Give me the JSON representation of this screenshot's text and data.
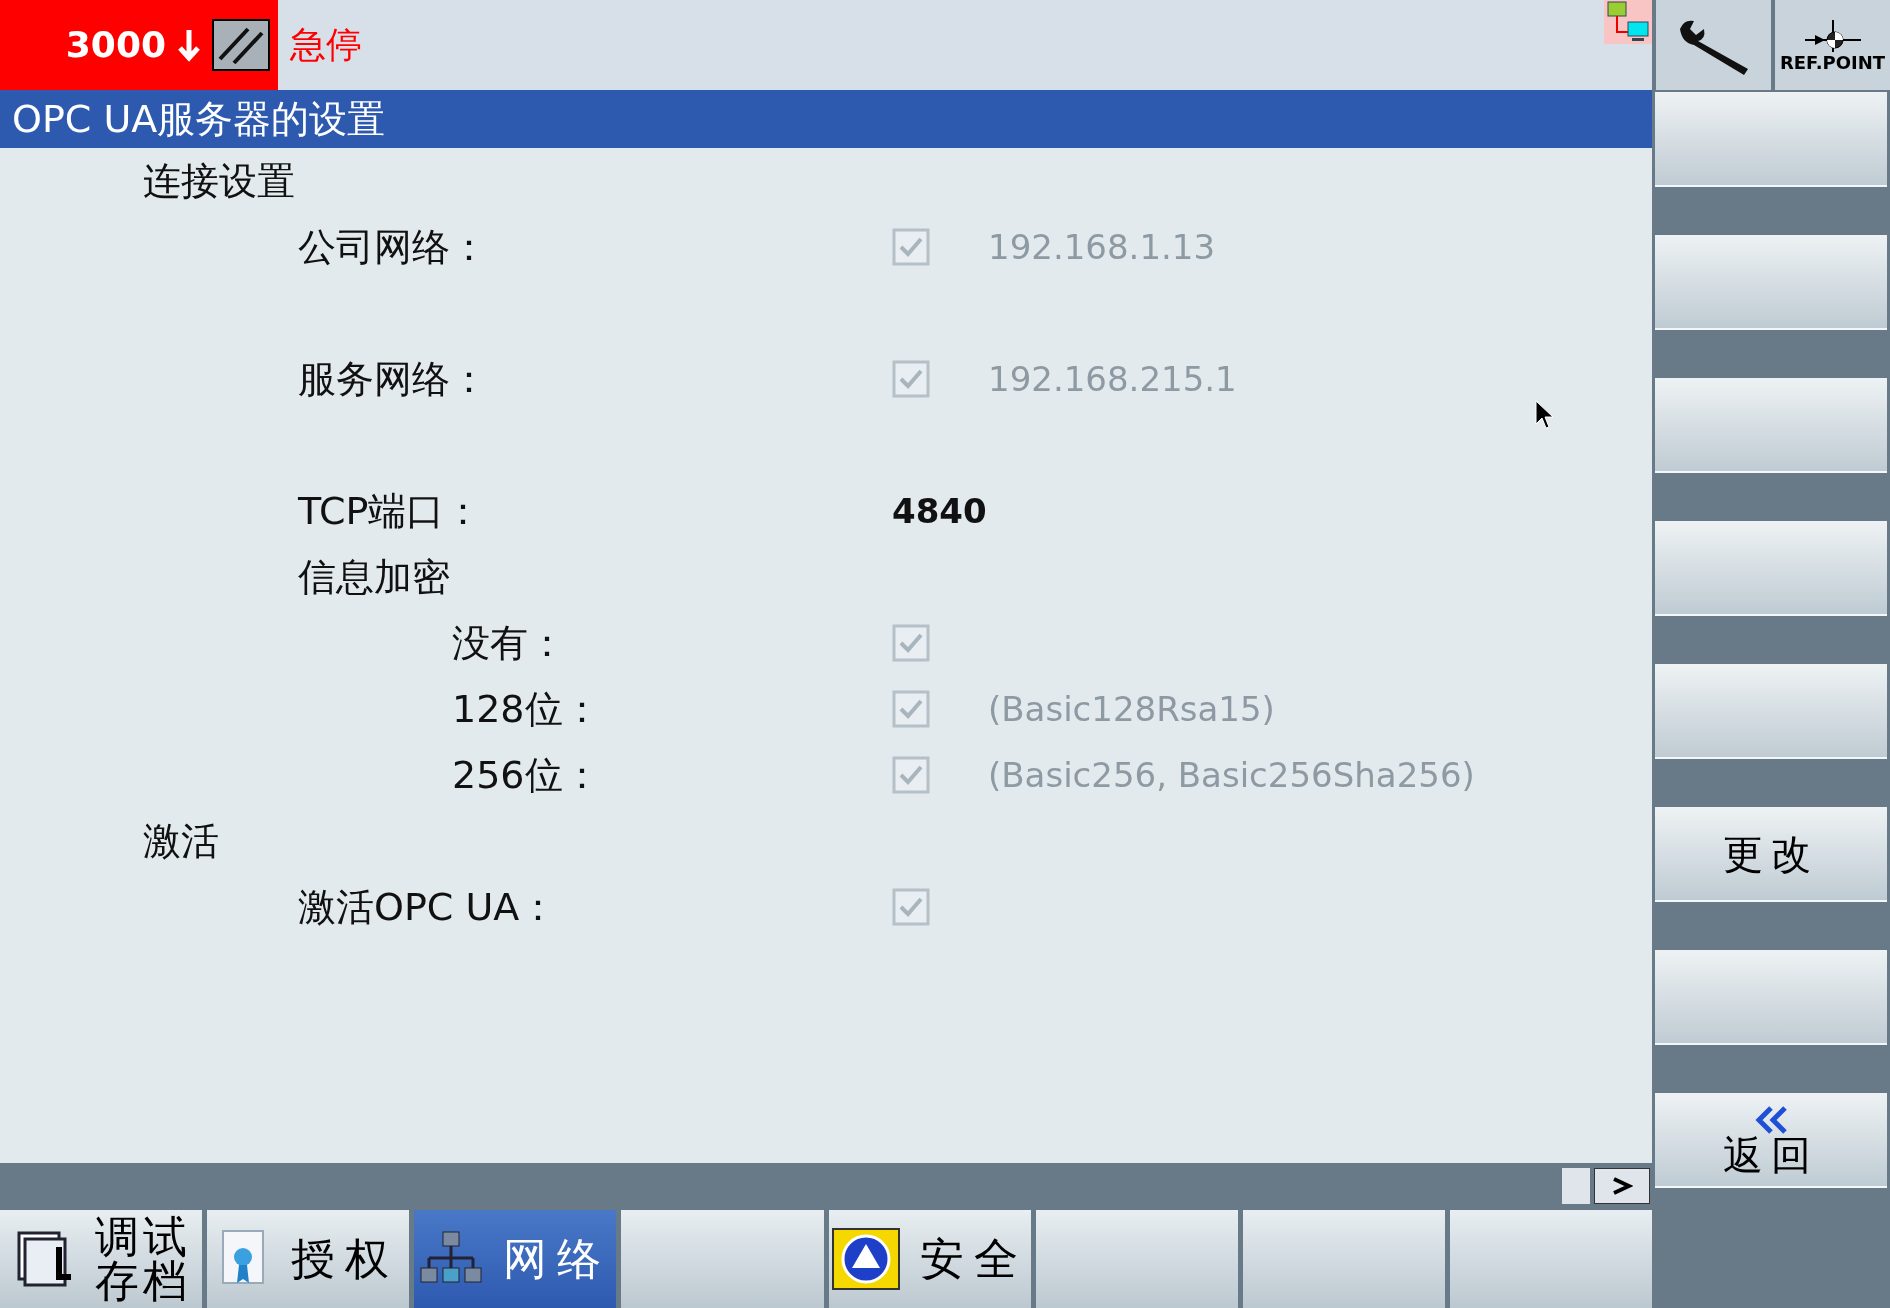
{
  "status": {
    "value": "3000",
    "alarm": "急停"
  },
  "title": "OPC UA服务器的设置",
  "sections": [
    {
      "label": "连接设置",
      "children": [
        {
          "kind": "check",
          "label": "公司网络：",
          "checked": true,
          "disabled": true,
          "value": "192.168.1.13"
        },
        {
          "kind": "check",
          "label": "服务网络：",
          "checked": true,
          "disabled": true,
          "value": "192.168.215.1"
        },
        {
          "kind": "text",
          "label": "TCP端口：",
          "value": "4840"
        },
        {
          "kind": "group",
          "label": "信息加密",
          "children": [
            {
              "kind": "check",
              "label": "没有：",
              "checked": true,
              "disabled": true
            },
            {
              "kind": "check",
              "label": "128位：",
              "checked": true,
              "disabled": true,
              "value": "(Basic128Rsa15)"
            },
            {
              "kind": "check",
              "label": "256位：",
              "checked": true,
              "disabled": true,
              "value": "(Basic256, Basic256Sha256)"
            }
          ]
        }
      ]
    },
    {
      "label": "激活",
      "children": [
        {
          "kind": "check",
          "label": "激活OPC UA：",
          "checked": true,
          "disabled": true
        }
      ]
    }
  ],
  "top_keys": [
    {
      "kind": "wrench"
    },
    {
      "kind": "refpoint",
      "label": "REF.POINT"
    }
  ],
  "side_keys": [
    {
      "kind": "blank"
    },
    {
      "kind": "blank"
    },
    {
      "kind": "blank"
    },
    {
      "kind": "blank"
    },
    {
      "kind": "blank"
    },
    {
      "kind": "text",
      "label": "更改"
    },
    {
      "kind": "blank"
    },
    {
      "kind": "back",
      "label": "返回"
    }
  ],
  "bottom_keys": [
    {
      "kind": "archive",
      "label": "调试存档",
      "selected": false
    },
    {
      "kind": "license",
      "label": "授权",
      "selected": false
    },
    {
      "kind": "network",
      "label": "网络",
      "selected": true
    },
    {
      "kind": "blank",
      "selected": false
    },
    {
      "kind": "safety",
      "label": "安全",
      "selected": false
    },
    {
      "kind": "blank",
      "selected": false
    },
    {
      "kind": "blank",
      "selected": false
    },
    {
      "kind": "blank",
      "selected": false
    }
  ]
}
